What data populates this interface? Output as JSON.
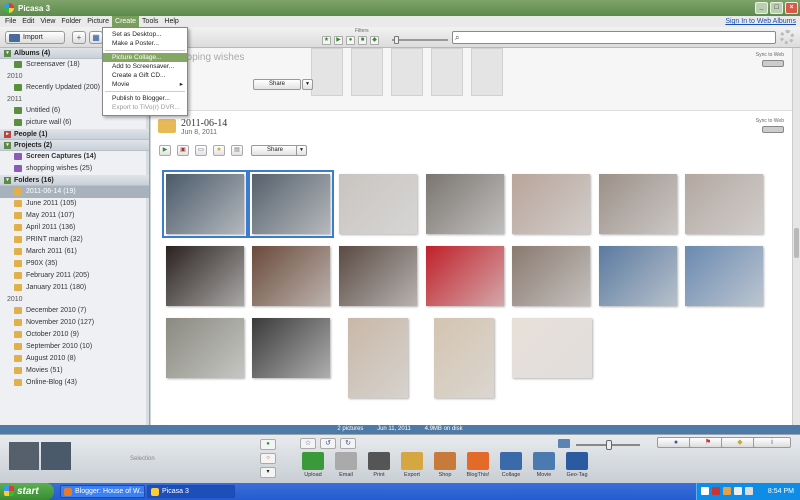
{
  "window": {
    "title": "Picasa 3"
  },
  "menu": {
    "items": [
      "File",
      "Edit",
      "View",
      "Folder",
      "Picture",
      "Create",
      "Tools",
      "Help"
    ],
    "active": "Create",
    "web_albums_link": "Sign In to Web Albums"
  },
  "create_menu": {
    "items": [
      {
        "label": "Set as Desktop...",
        "highlighted": false,
        "disabled": false
      },
      {
        "label": "Make a Poster...",
        "highlighted": false,
        "disabled": false
      },
      {
        "label": "Picture Collage...",
        "highlighted": true,
        "disabled": false
      },
      {
        "label": "Add to Screensaver...",
        "highlighted": false,
        "disabled": false
      },
      {
        "label": "Create a Gift CD...",
        "highlighted": false,
        "disabled": false
      },
      {
        "label": "Movie",
        "highlighted": false,
        "disabled": false,
        "submenu": true
      },
      {
        "label": "Publish to Blogger...",
        "highlighted": false,
        "disabled": false
      },
      {
        "label": "Export to TiVo(r) DVR...",
        "highlighted": false,
        "disabled": true
      }
    ]
  },
  "toolbar": {
    "import_label": "Import",
    "filters_label": "Filters",
    "search_placeholder": ""
  },
  "sidebar": {
    "albums": {
      "header": "Albums (4)",
      "groups": [
        {
          "year": "",
          "items": [
            "Screensaver (18)"
          ]
        },
        {
          "year": "2010",
          "items": [
            "Recently Updated (200)"
          ]
        },
        {
          "year": "2011",
          "items": [
            "Untitled (6)",
            "picture wall (6)"
          ]
        }
      ]
    },
    "people": {
      "header": "People (1)"
    },
    "projects": {
      "header": "Projects (2)",
      "items": [
        "Screen Captures (14)",
        "shopping wishes (25)"
      ]
    },
    "folders": {
      "header": "Folders (16)",
      "selected": "2011-06-14 (19)",
      "groups": [
        {
          "year": "",
          "items": [
            "2011-06-14 (19)",
            "June 2011 (105)",
            "May 2011 (107)",
            "April 2011 (136)",
            "PRINT march (32)",
            "March 2011 (61)",
            "P90X (35)",
            "February 2011 (205)",
            "January 2011 (180)"
          ]
        },
        {
          "year": "2010",
          "items": [
            "December 2010 (7)",
            "November 2010 (127)",
            "October 2010 (9)",
            "September 2010 (10)",
            "August 2010 (8)",
            "Movies (51)",
            "Online-Blog (43)"
          ]
        }
      ]
    }
  },
  "collage_strip": {
    "title": "opping wishes",
    "sync_label": "Sync to Web",
    "share_label": "Share"
  },
  "folder": {
    "title": "2011-06-14",
    "date": "Jun 8, 2011",
    "sync_label": "Sync to Web",
    "share_label": "Share"
  },
  "photos": {
    "row1": [
      "#4a5a6a",
      "#55606c",
      "#c8c4c0",
      "#7a7570",
      "#b8a49a",
      "#9c9088",
      "#b3a7a0"
    ],
    "row2": [
      "#2a2220",
      "#6a4a3a",
      "#5a4a42",
      "#c0202a",
      "#8a7a70",
      "#5a7aa0",
      "#6a8ab0"
    ],
    "row3": [
      "#8a8a80",
      "#3a3a3a",
      "#c8b8a8",
      "#d4c4b0",
      "#e8e0d8"
    ]
  },
  "status": {
    "selected": "2 pictures",
    "date": "Jun 11, 2011",
    "size": "4.9MB on disk"
  },
  "tray": {
    "selection_label": "Selection",
    "actions": [
      "Upload",
      "Email",
      "Print",
      "Export",
      "Shop",
      "BlogThis!",
      "Collage",
      "Movie",
      "Geo-Tag"
    ]
  },
  "taskbar": {
    "start_label": "start",
    "tasks": [
      "Blogger: House of W...",
      "Picasa 3"
    ],
    "clock": "8:54 PM"
  },
  "colors": {
    "accent_green": "#5c8a4c",
    "status_blue": "#4d7aa6",
    "selection_blue": "#3a7bd5"
  }
}
